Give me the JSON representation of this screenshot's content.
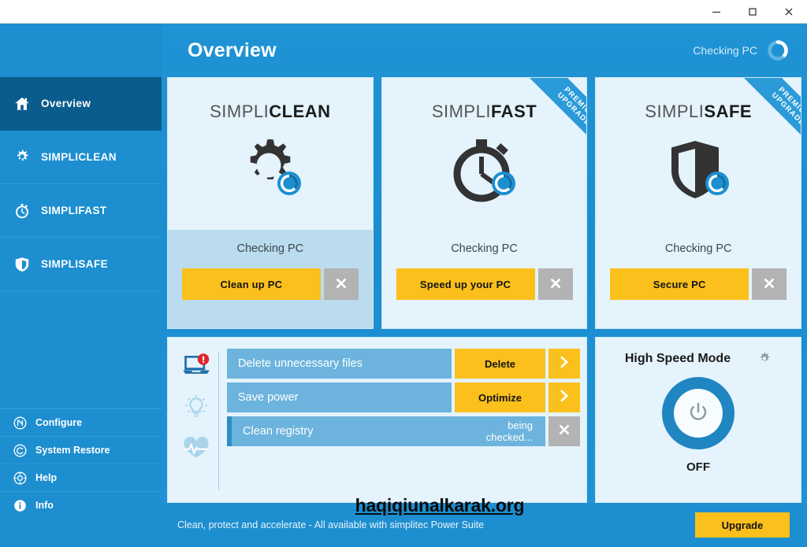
{
  "window": {
    "buttons": [
      {
        "name": "minimize",
        "glyph": "minimize-icon"
      },
      {
        "name": "maximize",
        "glyph": "maximize-icon"
      },
      {
        "name": "close",
        "glyph": "close-icon"
      }
    ]
  },
  "sidebar": {
    "items": [
      {
        "label": "Overview",
        "icon": "home-icon",
        "active": true
      },
      {
        "label": "SIMPLICLEAN",
        "icon": "gear-icon",
        "active": false
      },
      {
        "label": "SIMPLIFAST",
        "icon": "stopwatch-icon",
        "active": false
      },
      {
        "label": "SIMPLISAFE",
        "icon": "shield-icon",
        "active": false
      }
    ],
    "bottom_items": [
      {
        "label": "Configure",
        "icon": "configure-icon"
      },
      {
        "label": "System Restore",
        "icon": "restore-icon"
      },
      {
        "label": "Help",
        "icon": "help-icon"
      },
      {
        "label": "Info",
        "icon": "info-icon"
      }
    ]
  },
  "header": {
    "title": "Overview",
    "status_text": "Checking PC",
    "spinner_icon": "loading-spinner-icon"
  },
  "cards": [
    {
      "title_thin": "SIMPLI",
      "title_bold": "CLEAN",
      "icon": "gear-badge-icon",
      "status": "Checking PC",
      "action_label": "Clean up PC",
      "cancel_icon": "close-icon",
      "ribbon": null,
      "footer_shaded": true
    },
    {
      "title_thin": "SIMPLI",
      "title_bold": "FAST",
      "icon": "stopwatch-badge-icon",
      "status": "Checking PC",
      "action_label": "Speed up your PC",
      "cancel_icon": "close-icon",
      "ribbon": {
        "line1": "PREMIUM",
        "line2": "UPGRADE",
        "color": "#2b9ad8"
      },
      "footer_shaded": false
    },
    {
      "title_thin": "SIMPLI",
      "title_bold": "SAFE",
      "icon": "shield-badge-icon",
      "status": "Checking PC",
      "action_label": "Secure PC",
      "cancel_icon": "close-icon",
      "ribbon": {
        "line1": "PREMIUM",
        "line2": "UPGRADE",
        "color": "#2b9ad8"
      },
      "footer_shaded": false
    }
  ],
  "tasks": {
    "side_icons": [
      {
        "icon": "laptop-alert-icon",
        "state": "alert"
      },
      {
        "icon": "lightbulb-icon",
        "state": "idle"
      },
      {
        "icon": "heartbeat-icon",
        "state": "idle"
      }
    ],
    "rows": [
      {
        "label": "Delete unnecessary files",
        "action": "Delete",
        "trailing": "chevron-right-icon",
        "note": ""
      },
      {
        "label": "Save power",
        "action": "Optimize",
        "trailing": "chevron-right-icon",
        "note": ""
      },
      {
        "label": "Clean registry",
        "action": "",
        "trailing": "close-icon",
        "note": "being\nchecked..."
      }
    ]
  },
  "high_speed_mode": {
    "title": "High Speed Mode",
    "gear_icon": "gear-icon",
    "power_icon": "power-icon",
    "state": "OFF"
  },
  "footer": {
    "text": "Clean, protect and accelerate - All available with simplitec Power Suite",
    "upgrade_label": "Upgrade"
  },
  "watermark": {
    "text": "haqiqiunalkarak.org"
  },
  "colors": {
    "brand_blue": "#1d8ecf",
    "dark_blue": "#0a5c8c",
    "accent_yellow": "#fbc01c",
    "card_bg": "#e4f3fc",
    "card_foot_shaded": "#bbdcee",
    "task_row": "#6cb4dd",
    "grey_button": "#b3b3b3",
    "alert_red": "#e0252b"
  }
}
